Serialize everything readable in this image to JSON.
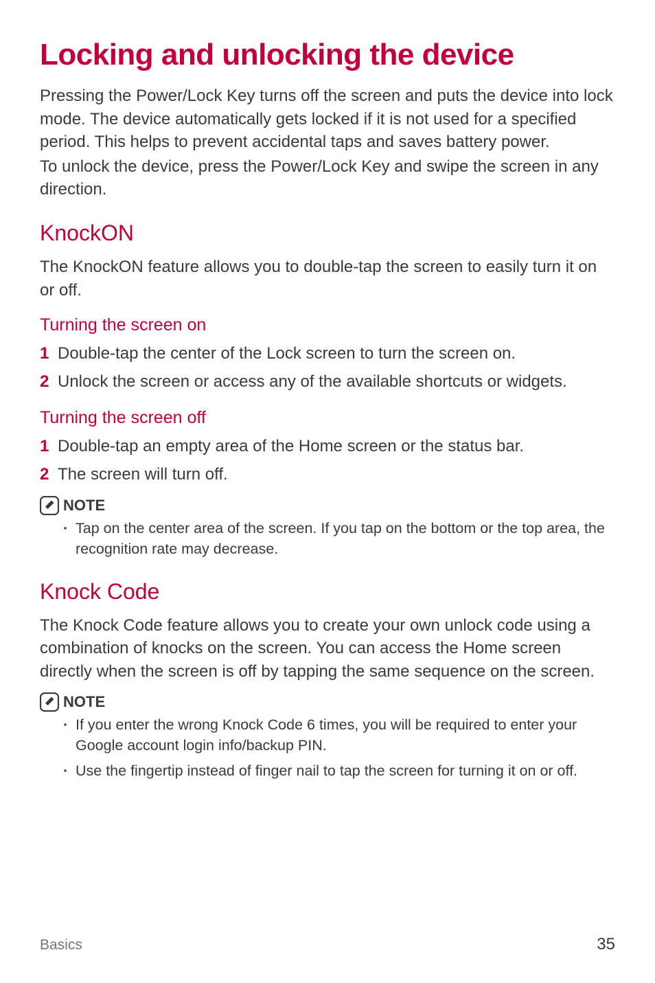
{
  "title": "Locking and unlocking the device",
  "intro_p1": "Pressing the Power/Lock Key turns off the screen and puts the device into lock mode. The device automatically gets locked if it is not used for a specified period. This helps to prevent accidental taps and saves battery power.",
  "intro_p2": "To unlock the device, press the Power/Lock Key and swipe the screen in any direction.",
  "knockon": {
    "heading": "KnockON",
    "desc": "The KnockON feature allows you to double-tap the screen to easily turn it on or off.",
    "turn_on": {
      "heading": "Turning the screen on",
      "steps": [
        "Double-tap the center of the Lock screen to turn the screen on.",
        "Unlock the screen or access any of the available shortcuts or widgets."
      ]
    },
    "turn_off": {
      "heading": "Turning the screen off",
      "steps": [
        "Double-tap an empty area of the Home screen or the status bar.",
        "The screen will turn off."
      ]
    },
    "note_label": "NOTE",
    "note_bullets": [
      "Tap on the center area of the screen. If you tap on the bottom or the top area, the recognition rate may decrease."
    ]
  },
  "knockcode": {
    "heading": "Knock Code",
    "desc": "The Knock Code feature allows you to create your own unlock code using a combination of knocks on the screen. You can access the Home screen directly when the screen is off by tapping the same sequence on the screen.",
    "note_label": "NOTE",
    "note_bullets": [
      "If you enter the wrong Knock Code 6 times, you will be required to enter your Google account login info/backup PIN.",
      "Use the fingertip instead of finger nail to tap the screen for turning it on or off."
    ]
  },
  "footer": {
    "section": "Basics",
    "page": "35"
  },
  "numbers": {
    "n1": "1",
    "n2": "2"
  },
  "bullet_char": "·"
}
